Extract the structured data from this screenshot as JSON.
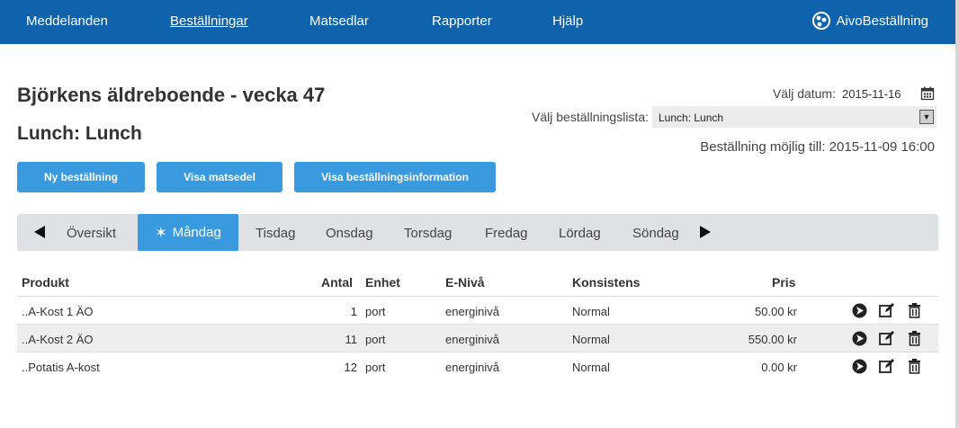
{
  "nav": {
    "items": [
      "Meddelanden",
      "Beställningar",
      "Matsedlar",
      "Rapporter",
      "Hjälp"
    ],
    "active": "Beställningar",
    "brand": "AivoBeställning"
  },
  "header": {
    "title": "Björkens äldreboende - vecka 47",
    "subtitle": "Lunch: Lunch"
  },
  "controls": {
    "date_label": "Välj datum:",
    "date_value": "2015-11-16",
    "list_label": "Välj beställningslista:",
    "list_value": "Lunch: Lunch",
    "deadline": "Beställning möjlig till: 2015-11-09 16:00"
  },
  "actions": {
    "new_order": "Ny beställning",
    "show_menu": "Visa matsedel",
    "show_info": "Visa beställningsinformation"
  },
  "tabs": {
    "overview": "Översikt",
    "days": [
      "Måndag",
      "Tisdag",
      "Onsdag",
      "Torsdag",
      "Fredag",
      "Lördag",
      "Söndag"
    ],
    "active": "Måndag"
  },
  "table": {
    "headers": [
      "Produkt",
      "Antal",
      "Enhet",
      "E-Nivå",
      "Konsistens",
      "Pris"
    ],
    "rows": [
      {
        "product": "..A-Kost 1 ÄO",
        "qty": "1",
        "unit": "port",
        "level": "energinivå",
        "consistency": "Normal",
        "price": "50.00 kr"
      },
      {
        "product": "..A-Kost 2 ÄO",
        "qty": "11",
        "unit": "port",
        "level": "energinivå",
        "consistency": "Normal",
        "price": "550.00 kr"
      },
      {
        "product": "..Potatis A-kost",
        "qty": "12",
        "unit": "port",
        "level": "energinivå",
        "consistency": "Normal",
        "price": "0.00 kr"
      }
    ]
  },
  "icons": {
    "brand": "aivo-logo-icon",
    "calendar": "calendar-icon",
    "row_actions": [
      "arrow-circle-icon",
      "edit-icon",
      "trash-icon"
    ]
  },
  "colors": {
    "nav_bg": "#0f63ad",
    "accent": "#3a9ae0",
    "tabbar_bg": "#dfe2e5"
  }
}
